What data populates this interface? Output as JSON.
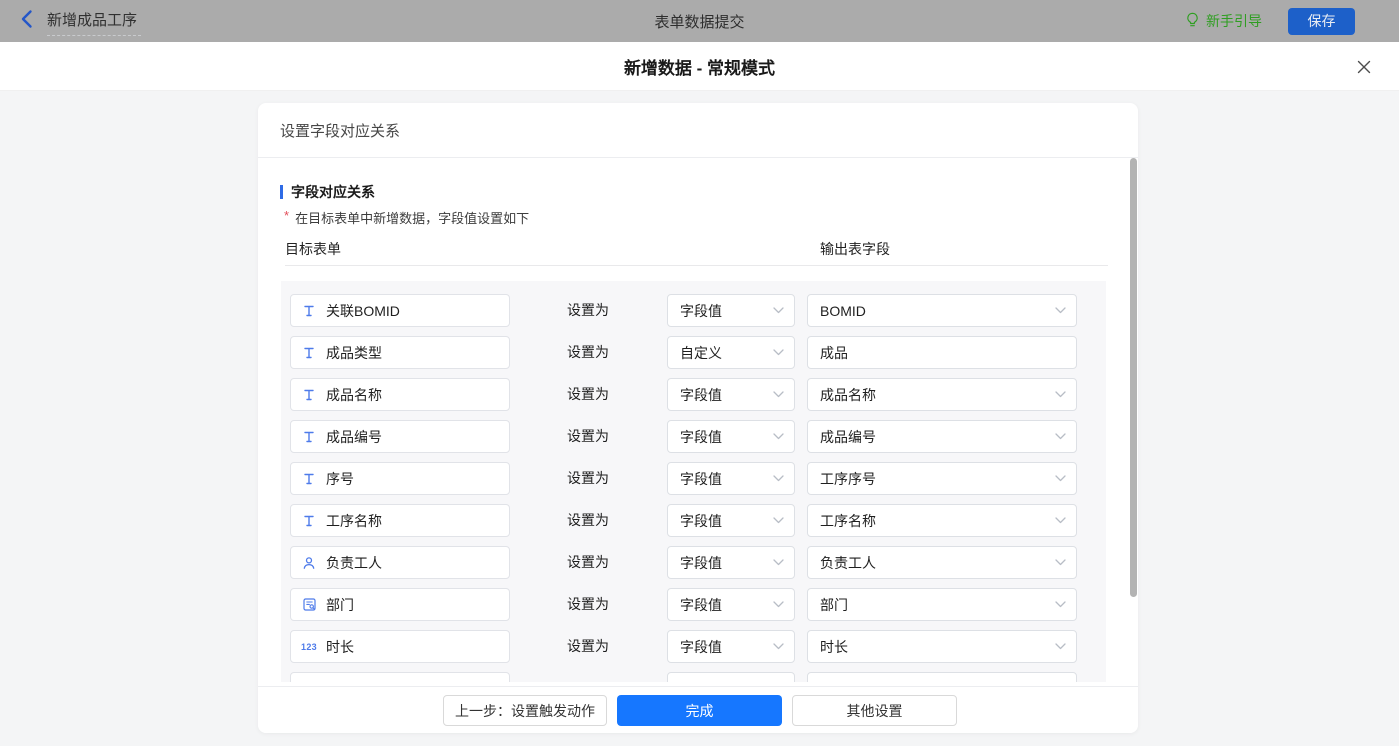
{
  "topbar": {
    "doc_title": "新增成品工序",
    "center_title": "表单数据提交",
    "guide_label": "新手引导",
    "save_label": "保存"
  },
  "modal": {
    "title": "新增数据 - 常规模式"
  },
  "card": {
    "header": "设置字段对应关系",
    "section_title": "字段对应关系",
    "required_mark": "*",
    "required_note": "在目标表单中新增数据，字段值设置如下",
    "col_left": "目标表单",
    "col_right": "输出表字段",
    "set_as_label": "设置为"
  },
  "rows": [
    {
      "icon": "text-field-icon",
      "field": "关联BOMID",
      "mode": "字段值",
      "value": "BOMID",
      "value_kind": "select"
    },
    {
      "icon": "text-field-icon",
      "field": "成品类型",
      "mode": "自定义",
      "value": "成品",
      "value_kind": "input"
    },
    {
      "icon": "text-field-icon",
      "field": "成品名称",
      "mode": "字段值",
      "value": "成品名称",
      "value_kind": "select"
    },
    {
      "icon": "text-field-icon",
      "field": "成品编号",
      "mode": "字段值",
      "value": "成品编号",
      "value_kind": "select"
    },
    {
      "icon": "text-field-icon",
      "field": "序号",
      "mode": "字段值",
      "value": "工序序号",
      "value_kind": "select"
    },
    {
      "icon": "text-field-icon",
      "field": "工序名称",
      "mode": "字段值",
      "value": "工序名称",
      "value_kind": "select"
    },
    {
      "icon": "user-icon",
      "field": "负责工人",
      "mode": "字段值",
      "value": "负责工人",
      "value_kind": "select"
    },
    {
      "icon": "department-icon",
      "field": "部门",
      "mode": "字段值",
      "value": "部门",
      "value_kind": "select"
    },
    {
      "icon": "number-icon",
      "field": "时长",
      "mode": "字段值",
      "value": "时长",
      "value_kind": "select"
    },
    {
      "icon": "none",
      "field": "",
      "mode": "",
      "value": "",
      "value_kind": "select",
      "clipped": true
    }
  ],
  "footer": {
    "prev_label": "上一步：设置触发动作",
    "done_label": "完成",
    "other_label": "其他设置"
  },
  "colors": {
    "accent_blue": "#4E7BEA",
    "primary_blue": "#1677FF",
    "guide_green": "#2F9E22",
    "danger_red": "#E34D59",
    "topbar_bg": "#ABABAB",
    "scrollbar": "#B3B3B3"
  }
}
